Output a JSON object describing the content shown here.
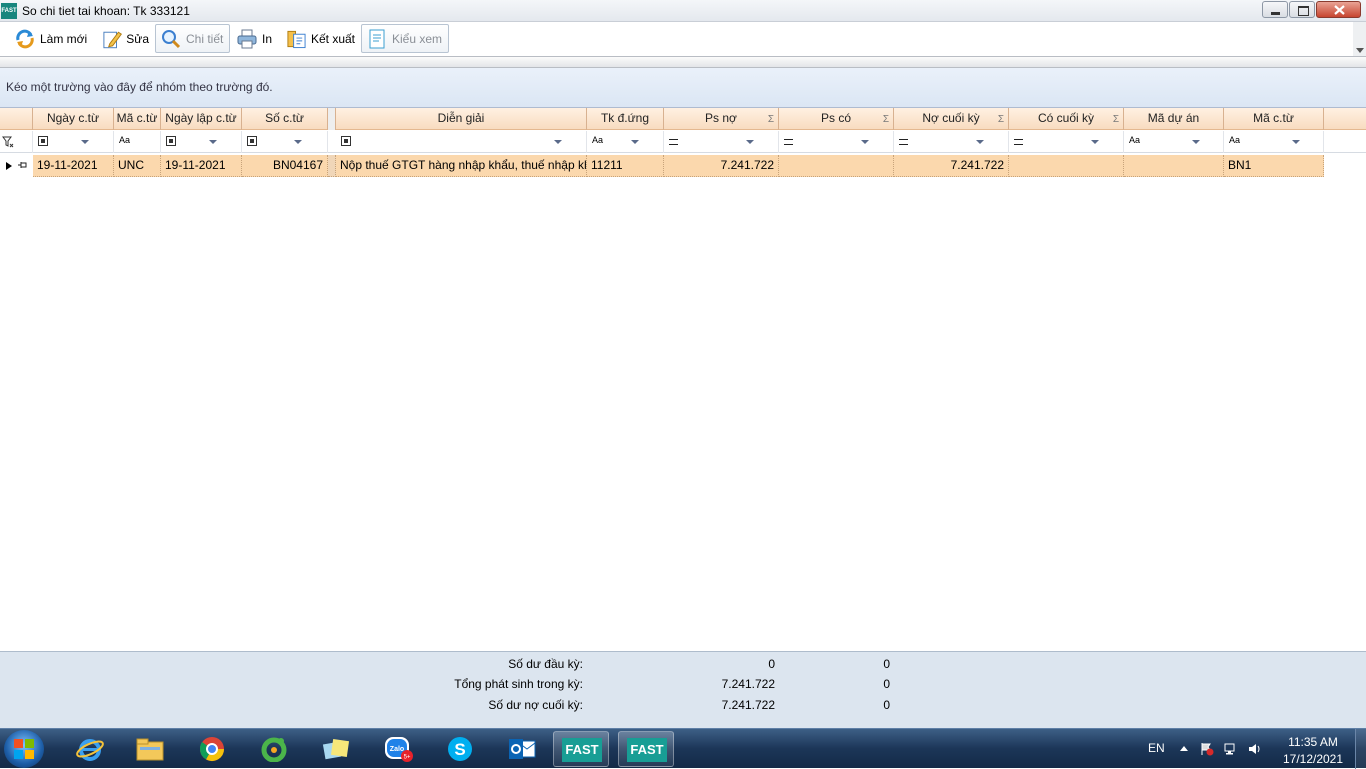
{
  "window": {
    "app_logo": "FAST",
    "title": "So chi tiet tai khoan: Tk 333121"
  },
  "toolbar": {
    "refresh": "Làm mới",
    "edit": "Sửa",
    "detail": "Chi tiết",
    "print": "In",
    "export": "Kết xuất",
    "view_style": "Kiểu xem"
  },
  "group_panel": {
    "hint": "Kéo một trường vào đây để nhóm theo trường đó."
  },
  "grid": {
    "columns": [
      {
        "key": "ngay_ctu",
        "label": "Ngày c.từ"
      },
      {
        "key": "ma_ct",
        "label": "Mã c.từ"
      },
      {
        "key": "ngay_lap",
        "label": "Ngày lập c.từ"
      },
      {
        "key": "so_ctu",
        "label": "Số c.từ"
      },
      {
        "key": "dien_giai",
        "label": "Diễn giải"
      },
      {
        "key": "tk_dung",
        "label": "Tk đ.ứng"
      },
      {
        "key": "ps_no",
        "label": "Ps nợ"
      },
      {
        "key": "ps_co",
        "label": "Ps có"
      },
      {
        "key": "no_cuoi_ky",
        "label": "Nợ cuối kỳ"
      },
      {
        "key": "co_cuoi_ky",
        "label": "Có cuối kỳ"
      },
      {
        "key": "ma_du_an",
        "label": "Mã dự án"
      },
      {
        "key": "ma_ctu2",
        "label": "Mã c.từ"
      }
    ],
    "filter_text_op": "Aa",
    "rows": [
      {
        "ngay_ctu": "19-11-2021",
        "ma_ct": "UNC",
        "ngay_lap": "19-11-2021",
        "so_ctu": "BN04167",
        "dien_giai": "Nộp thuế GTGT hàng nhập khẩu, thuế nhập khẩu",
        "tk_dung": "11211",
        "ps_no": "7.241.722",
        "ps_co": "",
        "no_cuoi_ky": "7.241.722",
        "co_cuoi_ky": "",
        "ma_du_an": "",
        "ma_ctu2": "BN1"
      }
    ]
  },
  "summary": {
    "opening": {
      "label": "Số dư đầu kỳ:",
      "debit": "0",
      "credit": "0"
    },
    "period": {
      "label": "Tổng phát sinh trong kỳ:",
      "debit": "7.241.722",
      "credit": "0"
    },
    "closing": {
      "label": "Số dư nợ cuối kỳ:",
      "debit": "7.241.722",
      "credit": "0"
    }
  },
  "taskbar": {
    "fast_label": "FAST",
    "zalo_label": "Zalo",
    "zalo_badge": "5+",
    "language": "EN",
    "time": "11:35 AM",
    "date": "17/12/2021"
  },
  "colors": {
    "selected_row": "#fbd8ad",
    "header_bg": "#f8dcc0",
    "fast_brand": "#189e95"
  }
}
